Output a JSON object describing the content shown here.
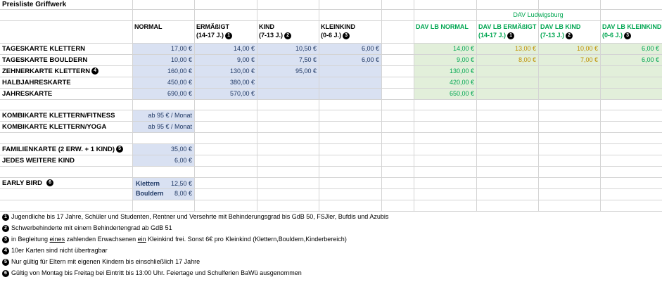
{
  "title": "Preisliste Griffwerk",
  "dav_header": "DAV Ludwigsburg",
  "headers": {
    "normal": "NORMAL",
    "ermaessigt": "ERMÄßIGT",
    "ermaessigt_sub": "(14-17 J.)",
    "kind": "KIND",
    "kind_sub": "(7-13 J.)",
    "kleinkind": "KLEINKIND",
    "kleinkind_sub": "(0-6 J.)",
    "dav_normal": "DAV LB NORMAL",
    "dav_ermaessigt": "DAV LB ERMÄßIGT",
    "dav_ermaessigt_sub": "(14-17 J.)",
    "dav_kind": "DAV LB KIND",
    "dav_kind_sub": "(7-13 J.)",
    "dav_kleinkind": "DAV LB KLEINKIND",
    "dav_kleinkind_sub": "(0-6 J.)"
  },
  "badges": [
    "1",
    "2",
    "3",
    "4",
    "5",
    "6"
  ],
  "rows": {
    "tageskarte_klettern": {
      "label": "TAGESKARTE KLETTERN",
      "normal": "17,00 €",
      "ermaessigt": "14,00 €",
      "kind": "10,50 €",
      "kleinkind": "6,00 €",
      "dav_normal": "14,00 €",
      "dav_ermaessigt": "13,00 €",
      "dav_kind": "10,00 €",
      "dav_kleinkind": "6,00 €"
    },
    "tageskarte_bouldern": {
      "label": "TAGESKARTE BOULDERN",
      "normal": "10,00 €",
      "ermaessigt": "9,00 €",
      "kind": "7,50 €",
      "kleinkind": "6,00 €",
      "dav_normal": "9,00 €",
      "dav_ermaessigt": "8,00 €",
      "dav_kind": "7,00 €",
      "dav_kleinkind": "6,00 €"
    },
    "zehnerkarte": {
      "label": "ZEHNERKARTE KLETTERN",
      "normal": "160,00 €",
      "ermaessigt": "130,00 €",
      "kind": "95,00 €",
      "dav_normal": "130,00 €"
    },
    "halbjahreskarte": {
      "label": "HALBJAHRESKARTE",
      "normal": "450,00 €",
      "ermaessigt": "380,00 €",
      "dav_normal": "420,00 €"
    },
    "jahreskarte": {
      "label": "JAHRESKARTE",
      "normal": "690,00 €",
      "ermaessigt": "570,00 €",
      "dav_normal": "650,00 €"
    }
  },
  "kombi": [
    {
      "label": "KOMBIKARTE KLETTERN/FITNESS",
      "price": "ab 95 € / Monat"
    },
    {
      "label": "KOMBIKARTE KLETTERN/YOGA",
      "price": "ab 95 € / Monat"
    }
  ],
  "familie": {
    "label": "FAMILIENKARTE (2 ERW. + 1 KIND)",
    "price": "35,00 €",
    "extra_label": "JEDES WEITERE KIND",
    "extra_price": "6,00 €"
  },
  "early_bird": {
    "label": "EARLY BIRD",
    "klettern_label": "Klettern",
    "klettern_price": "12,50 €",
    "bouldern_label": "Bouldern",
    "bouldern_price": "8,00 €"
  },
  "footnotes": {
    "1": "Jugendliche bis 17 Jahre, Schüler und Studenten, Rentner und Versehrte mit Behinderungsgrad bis GdB 50, FSJler, Bufdis und Azubis",
    "2": "Schwerbehinderte mit einem Behindertengrad ab GdB 51",
    "3_pre": "in Begleitung ",
    "3_eines": "eines",
    "3_mid": " zahlenden Erwachsenen ",
    "3_ein": "ein",
    "3_post": " Kleinkind frei. Sonst 6€ pro Kleinkind (Klettern,Bouldern,Kinderbereich)",
    "4": "10er Karten sind nicht übertragbar",
    "5": "Nur gültig für Eltern mit eigenen Kindern bis einschließlich 17 Jahre",
    "6": "Gültig von Montag bis Freitag bei Eintritt bis 13:00 Uhr. Feiertage und Schulferien BaWü ausgenommen"
  },
  "colors": {
    "blue_fill": "#d9e1f2",
    "green_fill": "#e2efda",
    "navy_text": "#1f3864",
    "green_text": "#00a651",
    "gold_text": "#bf9000",
    "grid": "#d4d4d4"
  }
}
